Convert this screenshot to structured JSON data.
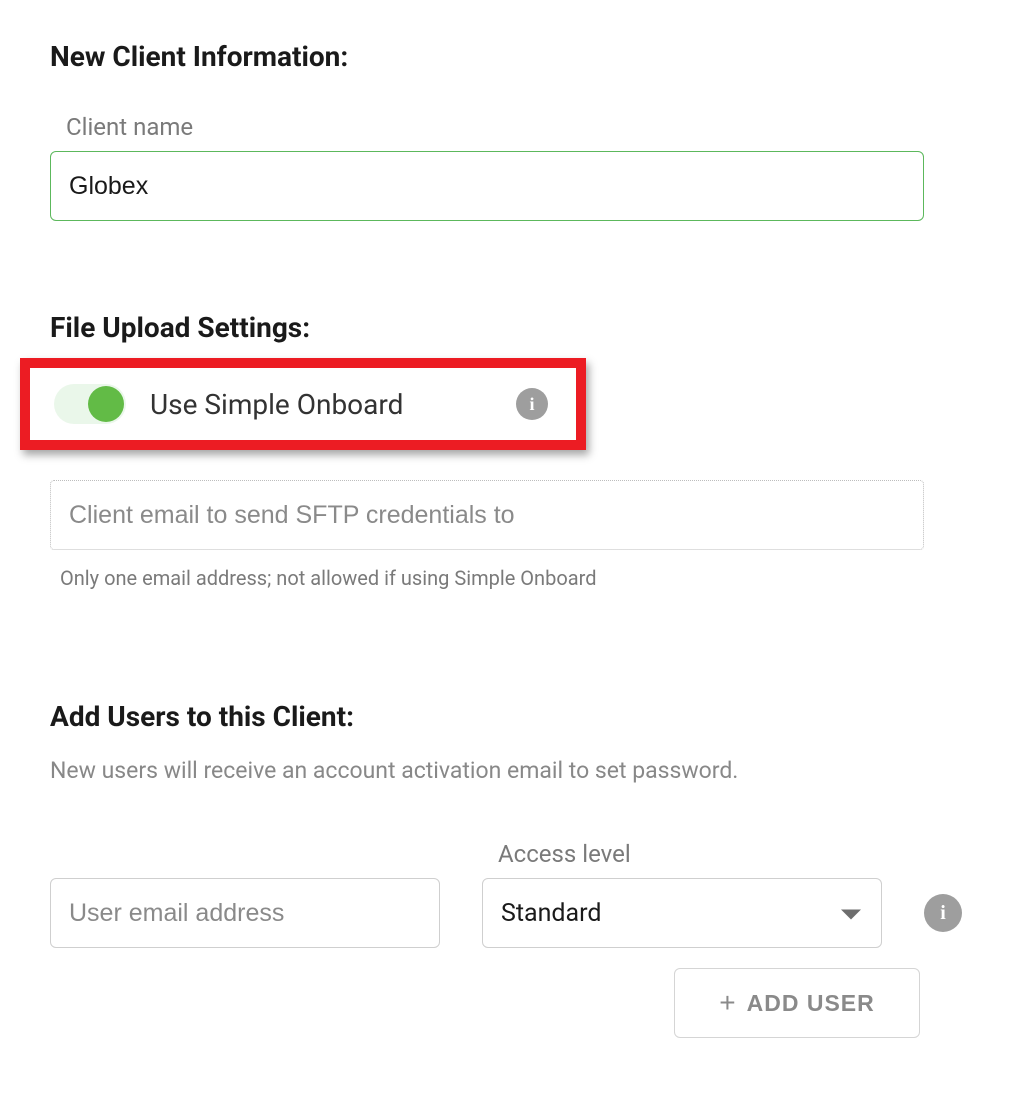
{
  "client_info": {
    "heading": "New Client Information:",
    "name_label": "Client name",
    "name_value": "Globex"
  },
  "file_upload": {
    "heading": "File Upload Settings:",
    "toggle_label": "Use Simple Onboard",
    "toggle_on": true,
    "sftp_email_placeholder": "Client email to send SFTP credentials to",
    "sftp_helper": "Only one email address; not allowed if using Simple Onboard"
  },
  "add_users": {
    "heading": "Add Users to this Client:",
    "description": "New users will receive an account activation email to set password.",
    "email_placeholder": "User email address",
    "access_label": "Access level",
    "access_value": "Standard",
    "add_button_label": "ADD USER"
  }
}
